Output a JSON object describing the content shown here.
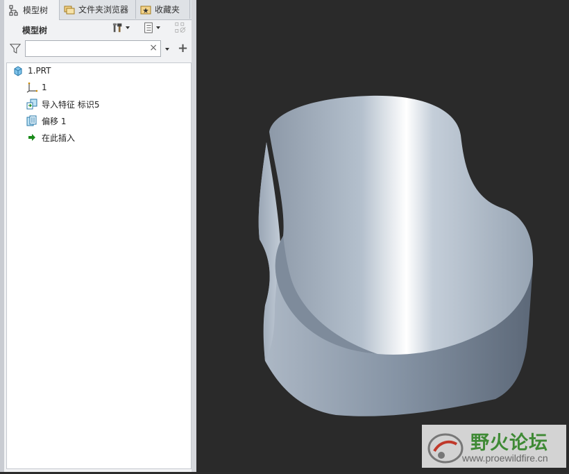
{
  "tabs": [
    {
      "label": "模型树",
      "icon": "model-tree-icon",
      "active": true
    },
    {
      "label": "文件夹浏览器",
      "icon": "folder-browser-icon",
      "active": false
    },
    {
      "label": "收藏夹",
      "icon": "favorites-icon",
      "active": false
    }
  ],
  "panel": {
    "title": "模型树",
    "settings_icon": "tools-icon",
    "columns_icon": "tree-columns-icon",
    "filter_icon": "filter-icon",
    "disabled_icon": "show-hide-icon"
  },
  "search": {
    "value": "",
    "clear_glyph": "×",
    "add_glyph": "+"
  },
  "tree": {
    "root": {
      "label": "1.PRT",
      "icon": "part-icon"
    },
    "items": [
      {
        "label": "1",
        "icon": "coordinate-system-icon"
      },
      {
        "label": "导入特征 标识5",
        "icon": "import-feature-icon"
      },
      {
        "label": "偏移 1",
        "icon": "offset-icon"
      },
      {
        "label": "在此插入",
        "icon": "insert-here-arrow-icon"
      }
    ]
  },
  "watermark": {
    "title": "野火论坛",
    "url": "www.proewildfire.cn"
  },
  "colors": {
    "panel_bg": "#f1f2f4",
    "viewport_bg": "#2a2a2a",
    "insert_arrow": "#1a8a1a",
    "watermark_green": "#3f8a35"
  }
}
